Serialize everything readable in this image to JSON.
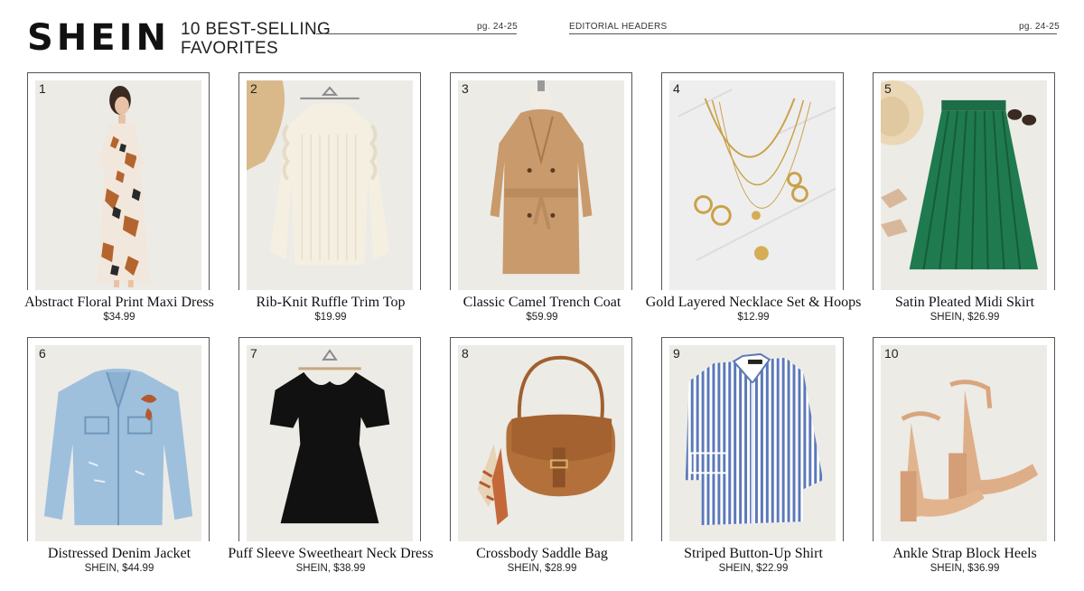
{
  "header": {
    "brand": "SHEIN",
    "title_line1": "10 BEST-SELLING",
    "title_line2": "FAVORITES",
    "page_left": "pg. 24-25",
    "section": "EDITORIAL HEADERS",
    "page_right": "pg. 24-25"
  },
  "products": [
    {
      "number": "1",
      "name": "Abstract Floral Print Maxi Dress",
      "price": "$34.99",
      "icon": "floral-maxi-dress-photo"
    },
    {
      "number": "2",
      "name": "Rib-Knit Ruffle Trim Top",
      "price": "$19.99",
      "icon": "ruffle-top-photo"
    },
    {
      "number": "3",
      "name": "Classic Camel Trench Coat",
      "price": "$59.99",
      "icon": "trench-coat-photo"
    },
    {
      "number": "4",
      "name": "Gold Layered Necklace Set & Hoops",
      "price": "$12.99",
      "icon": "necklace-set-photo"
    },
    {
      "number": "5",
      "name": "Satin Pleated Midi Skirt",
      "price": "SHEIN, $26.99",
      "icon": "pleated-skirt-photo"
    },
    {
      "number": "6",
      "name": "Distressed Denim Jacket",
      "price": "SHEIN, $44.99",
      "icon": "denim-jacket-photo"
    },
    {
      "number": "7",
      "name": "Puff Sleeve Sweetheart Neck Dress",
      "price": "SHEIN, $38.99",
      "icon": "black-dress-photo"
    },
    {
      "number": "8",
      "name": "Crossbody Saddle Bag",
      "price": "SHEIN, $28.99",
      "icon": "saddle-bag-photo"
    },
    {
      "number": "9",
      "name": "Striped Button-Up Shirt",
      "price": "SHEIN, $22.99",
      "icon": "striped-shirt-photo"
    },
    {
      "number": "10",
      "name": "Ankle Strap Block Heels",
      "price": "SHEIN, $36.99",
      "icon": "block-heels-photo"
    }
  ]
}
